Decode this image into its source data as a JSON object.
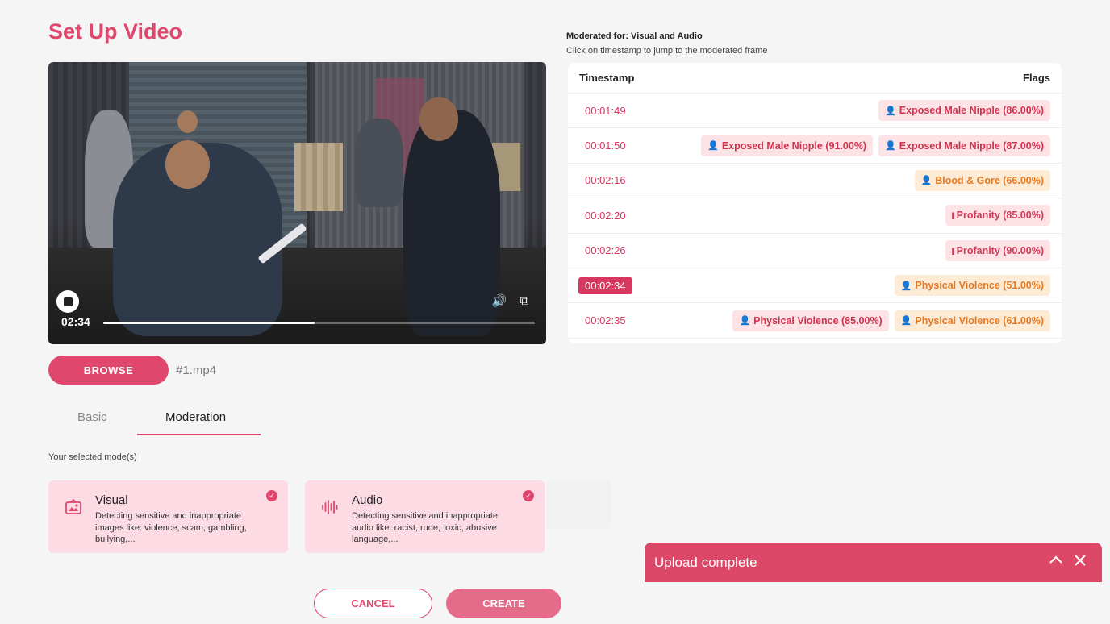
{
  "page": {
    "title": "Set Up Video"
  },
  "video": {
    "current_time": "02:34",
    "progress_fraction": 0.49
  },
  "upload": {
    "browse_label": "BROWSE",
    "filename": "#1.mp4"
  },
  "tabs": [
    {
      "label": "Basic",
      "active": false
    },
    {
      "label": "Moderation",
      "active": true
    }
  ],
  "modes": {
    "label": "Your selected mode(s)",
    "visual": {
      "name": "Visual",
      "description": "Detecting sensitive and inappropriate images like: violence, scam, gambling, bullying,...",
      "icon": "image-icon"
    },
    "audio": {
      "name": "Audio",
      "description": "Detecting sensitive and inappropriate audio like: racist, rude, toxic, abusive language,...",
      "icon": "waveform-icon"
    }
  },
  "footer": {
    "cancel_label": "CANCEL",
    "create_label": "CREATE"
  },
  "moderation": {
    "title": "Moderated for: Visual and Audio",
    "subtitle": "Click on timestamp to jump to the moderated frame",
    "col_timestamp": "Timestamp",
    "col_flags": "Flags",
    "rows": [
      {
        "ts": "00:01:49",
        "flags": [
          {
            "label": "Exposed Male Nipple (86.00%)",
            "kind": "red",
            "icon": "person-icon"
          }
        ]
      },
      {
        "ts": "00:01:50",
        "flags": [
          {
            "label": "Exposed Male Nipple (91.00%)",
            "kind": "red",
            "icon": "person-icon"
          },
          {
            "label": "Exposed Male Nipple (87.00%)",
            "kind": "red",
            "icon": "person-icon"
          }
        ]
      },
      {
        "ts": "00:02:16",
        "flags": [
          {
            "label": "Blood & Gore (66.00%)",
            "kind": "orange",
            "icon": "person-icon"
          }
        ]
      },
      {
        "ts": "00:02:20",
        "flags": [
          {
            "label": "Profanity (85.00%)",
            "kind": "pink",
            "icon": "waveform-icon"
          }
        ]
      },
      {
        "ts": "00:02:26",
        "flags": [
          {
            "label": "Profanity (90.00%)",
            "kind": "pink",
            "icon": "waveform-icon"
          }
        ]
      },
      {
        "ts": "00:02:34",
        "active": true,
        "flags": [
          {
            "label": "Physical Violence (51.00%)",
            "kind": "orange",
            "icon": "person-icon"
          }
        ]
      },
      {
        "ts": "00:02:35",
        "flags": [
          {
            "label": "Physical Violence (85.00%)",
            "kind": "red",
            "icon": "person-icon"
          },
          {
            "label": "Physical Violence (61.00%)",
            "kind": "orange",
            "icon": "person-icon"
          }
        ]
      }
    ]
  },
  "toast": {
    "text": "Upload complete"
  },
  "colors": {
    "accent": "#e0476c",
    "flag_red": "#d0314c",
    "flag_orange": "#e47a24"
  }
}
